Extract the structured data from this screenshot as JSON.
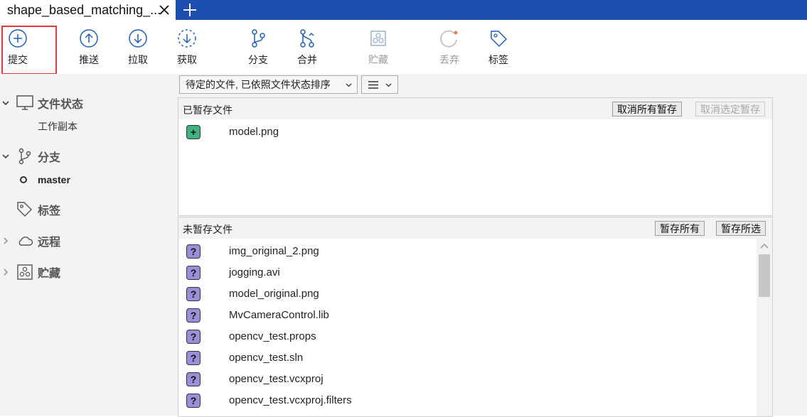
{
  "tab": {
    "title": "shape_based_matching_..."
  },
  "toolbar": {
    "commit": "提交",
    "push": "推送",
    "pull": "拉取",
    "fetch": "获取",
    "branch": "分支",
    "merge": "合并",
    "stash": "贮藏",
    "discard": "丢弃",
    "tag": "标签"
  },
  "sidebar": {
    "file_status": "文件状态",
    "working_copy": "工作副本",
    "branches": "分支",
    "current_branch": "master",
    "tags": "标签",
    "remotes": "远程",
    "stashes": "贮藏"
  },
  "filter": {
    "sort_label": "待定的文件, 已依照文件状态排序"
  },
  "staged": {
    "title": "已暂存文件",
    "unstage_all": "取消所有暂存",
    "unstage_selected": "取消选定暂存",
    "files": [
      "model.png"
    ]
  },
  "unstaged": {
    "title": "未暂存文件",
    "stage_all": "暂存所有",
    "stage_selected": "暂存所选",
    "files": [
      "img_original_2.png",
      "jogging.avi",
      "model_original.png",
      "MvCameraControl.lib",
      "opencv_test.props",
      "opencv_test.sln",
      "opencv_test.vcxproj",
      "opencv_test.vcxproj.filters"
    ]
  },
  "colors": {
    "tabbar": "#1e4fb0",
    "icon_blue": "#1e5fc0",
    "unknown_file": "#9b8ed9",
    "added_file": "#3fb27f",
    "highlight": "#e23a3a"
  }
}
